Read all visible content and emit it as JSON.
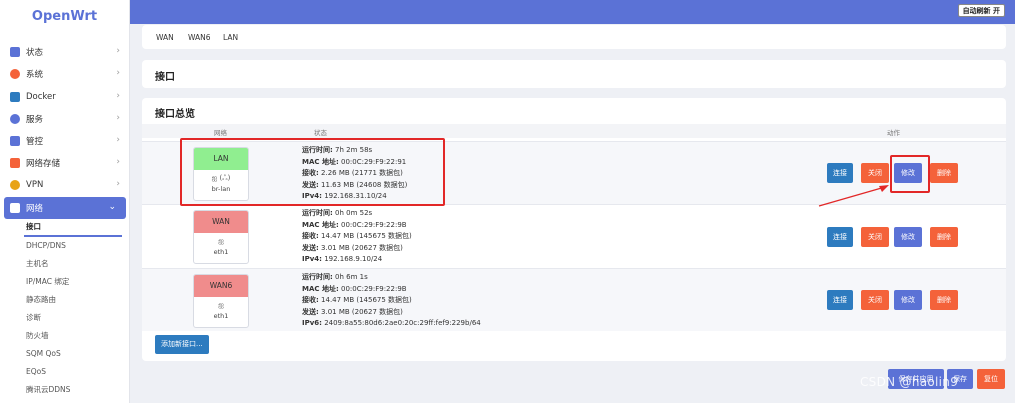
{
  "app": {
    "logo": "OpenWrt",
    "auto_refresh": "自动刷新 开"
  },
  "sidebar": {
    "items": [
      {
        "label": "状态",
        "icon": "status-icon",
        "color": "#5b72d6"
      },
      {
        "label": "系统",
        "icon": "gear-icon",
        "color": "#f4623a"
      },
      {
        "label": "Docker",
        "icon": "docker-icon",
        "color": "#2d7bbf"
      },
      {
        "label": "服务",
        "icon": "service-icon",
        "color": "#5b72d6"
      },
      {
        "label": "管控",
        "icon": "control-icon",
        "color": "#5b72d6"
      },
      {
        "label": "网络存储",
        "icon": "storage-icon",
        "color": "#f4623a"
      },
      {
        "label": "VPN",
        "icon": "vpn-icon",
        "color": "#e8a317"
      },
      {
        "label": "网络",
        "icon": "network-icon",
        "color": "#ffffff"
      }
    ],
    "sub_items": [
      "接口",
      "DHCP/DNS",
      "主机名",
      "IP/MAC 绑定",
      "静态路由",
      "诊断",
      "防火墙",
      "SQM QoS",
      "EQoS",
      "腾讯云DDNS"
    ]
  },
  "tabs": [
    "WAN",
    "WAN6",
    "LAN"
  ],
  "page_title": "接口",
  "overview": {
    "title": "接口总览",
    "columns": {
      "network": "网络",
      "status": "状态",
      "actions": "动作"
    },
    "rows": [
      {
        "name": "LAN",
        "device": "br-lan",
        "icon_text": "ஐ (ஃ)",
        "head_color": "#90ee90",
        "lines": [
          {
            "label": "运行时间:",
            "value": " 7h 2m 58s"
          },
          {
            "label": "MAC 地址:",
            "value": " 00:0C:29:F9:22:91"
          },
          {
            "label": "接收:",
            "value": " 2.26 MB (21771 数据包)"
          },
          {
            "label": "发送:",
            "value": " 11.63 MB (24608 数据包)"
          },
          {
            "label": "IPv4:",
            "value": " 192.168.31.10/24"
          }
        ]
      },
      {
        "name": "WAN",
        "device": "eth1",
        "icon_text": "ஐ",
        "head_color": "#f08c8c",
        "lines": [
          {
            "label": "运行时间:",
            "value": " 0h 0m 52s"
          },
          {
            "label": "MAC 地址:",
            "value": " 00:0C:29:F9:22:9B"
          },
          {
            "label": "接收:",
            "value": " 14.47 MB (145675 数据包)"
          },
          {
            "label": "发送:",
            "value": " 3.01 MB (20627 数据包)"
          },
          {
            "label": "IPv4:",
            "value": " 192.168.9.10/24"
          }
        ]
      },
      {
        "name": "WAN6",
        "device": "eth1",
        "icon_text": "ஐ",
        "head_color": "#f08c8c",
        "lines": [
          {
            "label": "运行时间:",
            "value": " 0h 6m 1s"
          },
          {
            "label": "MAC 地址:",
            "value": " 00:0C:29:F9:22:9B"
          },
          {
            "label": "接收:",
            "value": " 14.47 MB (145675 数据包)"
          },
          {
            "label": "发送:",
            "value": " 3.01 MB (20627 数据包)"
          },
          {
            "label": "IPv6:",
            "value": " 2409:8a55:80d6:2ae0:20c:29ff:fef9:229b/64"
          }
        ]
      }
    ],
    "buttons": {
      "connect": "连接",
      "close": "关闭",
      "edit": "修改",
      "delete": "删除"
    },
    "add": "添加新接口..."
  },
  "footer": {
    "save_apply": "保存并应用",
    "save": "保存",
    "reset": "复位"
  },
  "watermark": "CSDN @haolin9"
}
